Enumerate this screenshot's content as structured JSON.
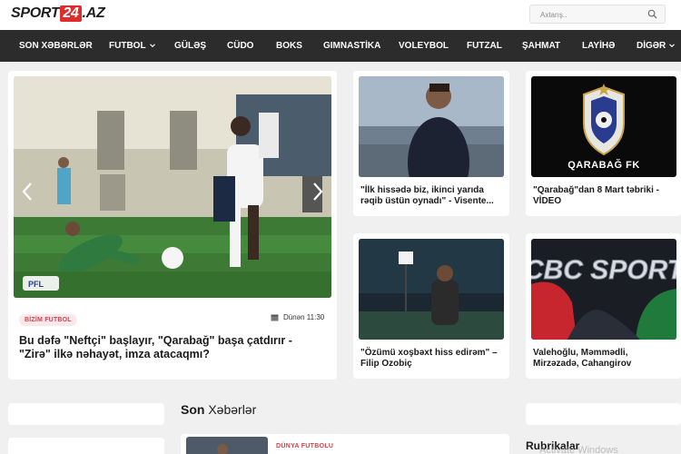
{
  "header": {
    "logo_part1": "SPORT",
    "logo_part2": "24",
    "logo_part3": ".AZ",
    "search_placeholder": "Axtarış..",
    "search_icon": "search-icon"
  },
  "nav": {
    "items": [
      {
        "label": "SON XƏBƏRLƏR"
      },
      {
        "label": "FUTBOL",
        "has_dropdown": true
      },
      {
        "label": "GÜLƏŞ"
      },
      {
        "label": "CÜDO"
      },
      {
        "label": "BOKS"
      },
      {
        "label": "GIMNASTİKA"
      },
      {
        "label": "VOLEYBOL"
      },
      {
        "label": "FUTZAL"
      },
      {
        "label": "ŞAHMAT"
      },
      {
        "label": "LAYİHƏ"
      },
      {
        "label": "DİGƏR",
        "has_dropdown": true
      }
    ]
  },
  "featured": {
    "tag": "BİZİM FUTBOL",
    "date": "Dünən 11:30",
    "title": "Bu dəfə \"Neftçi\" başlayır, \"Qarabağ\" başa çatdırır - \"Zirə\" ilkə nəhayət, imza atacaqmı?",
    "logo_badge": "PFL"
  },
  "grid": [
    {
      "title": "\"İlk hissədə biz, ikinci yarıda rəqib üstün oynadı\" - Visente..."
    },
    {
      "title": "\"Qarabağ\"dan 8 Mart təbriki - VİDEO",
      "image_caption": "QARABAĞ FK"
    },
    {
      "title": "\"Özümü xoşbəxt hiss edirəm\" – Filip Ozobiç"
    },
    {
      "title": "Valehoğlu, Məmmədli, Mirzəzadə, Cahangirov",
      "image_caption": "CBC SPORT"
    }
  ],
  "latest": {
    "heading_bold": "Son",
    "heading_rest": " Xəbərlər",
    "sub_tag": "DÜNYA FUTBOLU"
  },
  "sidebar": {
    "rubrikalar": "Rubrikalar"
  },
  "overlay": {
    "watermark": "Activate Windows"
  },
  "colors": {
    "accent": "#e02b2b",
    "nav_bg": "#2c2c2c",
    "page_bg": "#f0f0f0",
    "tag_bg": "#fce8ea",
    "tag_text": "#d6404f"
  }
}
